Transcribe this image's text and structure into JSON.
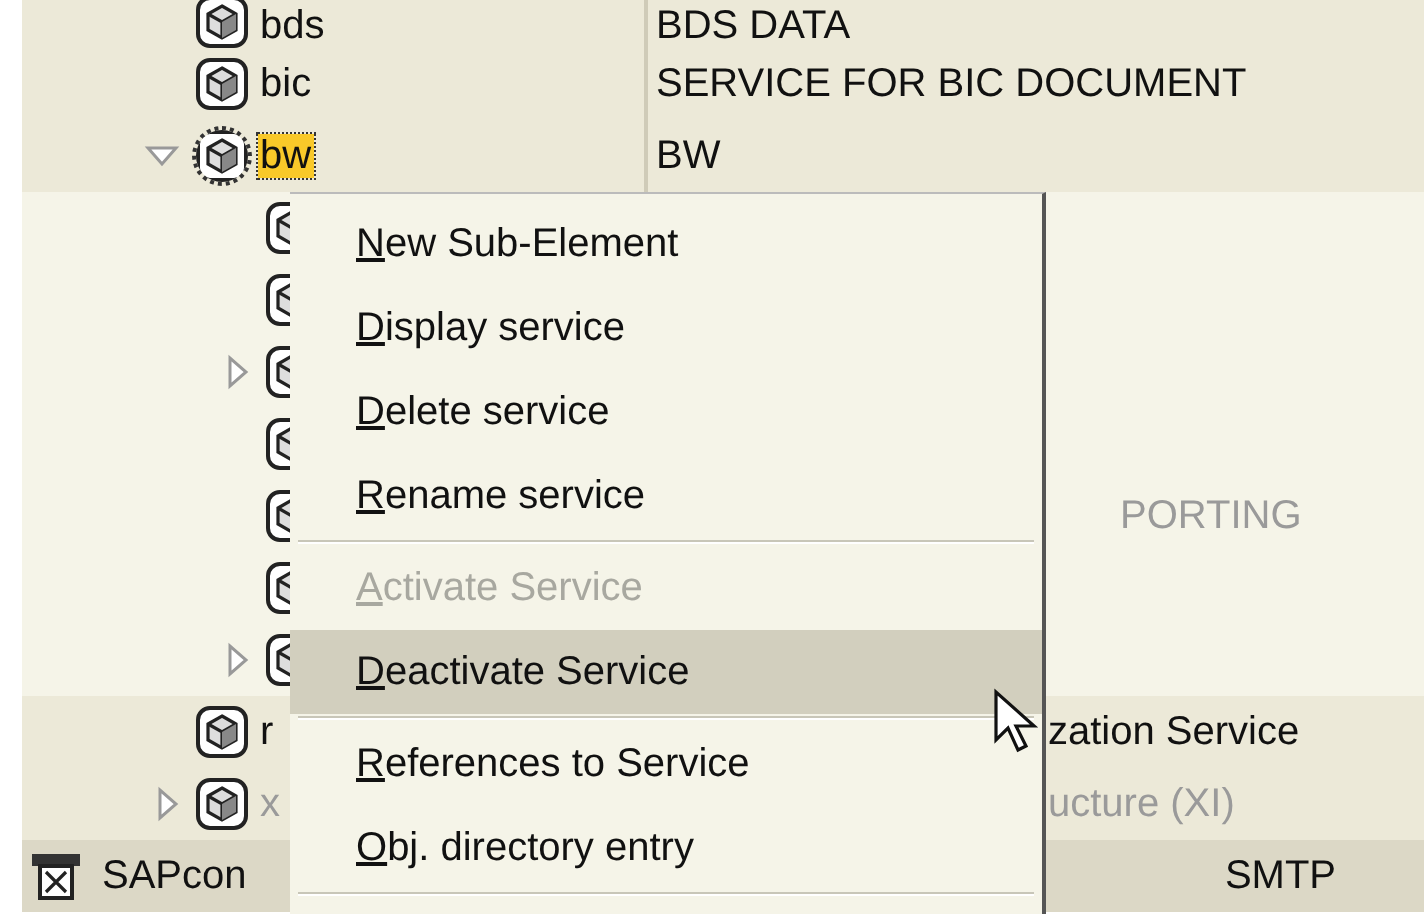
{
  "tree": {
    "items": [
      {
        "name": "bds",
        "description": "BDS DATA",
        "selected": false,
        "inactive": false
      },
      {
        "name": "bic",
        "description": "SERVICE FOR BIC DOCUMENT",
        "selected": false,
        "inactive": false
      },
      {
        "name": "bw",
        "description": "BW",
        "expanded": true,
        "selected": true,
        "inactive": false,
        "children": [
          {
            "kind": "service"
          },
          {
            "kind": "service"
          },
          {
            "kind": "service",
            "expanded": false
          },
          {
            "kind": "service"
          },
          {
            "kind": "service",
            "description": "PORTING",
            "clipped": true,
            "inactive": true
          },
          {
            "kind": "service"
          },
          {
            "kind": "service",
            "expanded": false
          }
        ]
      },
      {
        "name": "r",
        "description": "zation Service",
        "clipped": true,
        "selected": false,
        "inactive": false
      },
      {
        "name": "x",
        "description": "ucture (XI)",
        "clipped": true,
        "expanded": false,
        "selected": false,
        "inactive": true
      }
    ],
    "next_root": {
      "name": "SAPcon",
      "description": "SMTP",
      "clipped": true
    }
  },
  "context_menu": [
    {
      "kind": "item",
      "label": "New Sub-Element",
      "disabled": false,
      "selected": false
    },
    {
      "kind": "item",
      "label": "Display service",
      "disabled": false,
      "selected": false
    },
    {
      "kind": "item",
      "label": "Delete service",
      "disabled": false,
      "selected": false
    },
    {
      "kind": "item",
      "label": "Rename service",
      "disabled": false,
      "selected": false
    },
    {
      "kind": "separator"
    },
    {
      "kind": "item",
      "label": "Activate Service",
      "disabled": true,
      "selected": false
    },
    {
      "kind": "item",
      "label": "Deactivate Service",
      "disabled": false,
      "selected": true
    },
    {
      "kind": "separator"
    },
    {
      "kind": "item",
      "label": "References to Service",
      "disabled": false,
      "selected": false
    },
    {
      "kind": "item",
      "label": "Obj. directory entry",
      "disabled": false,
      "selected": false
    },
    {
      "kind": "separator"
    }
  ]
}
